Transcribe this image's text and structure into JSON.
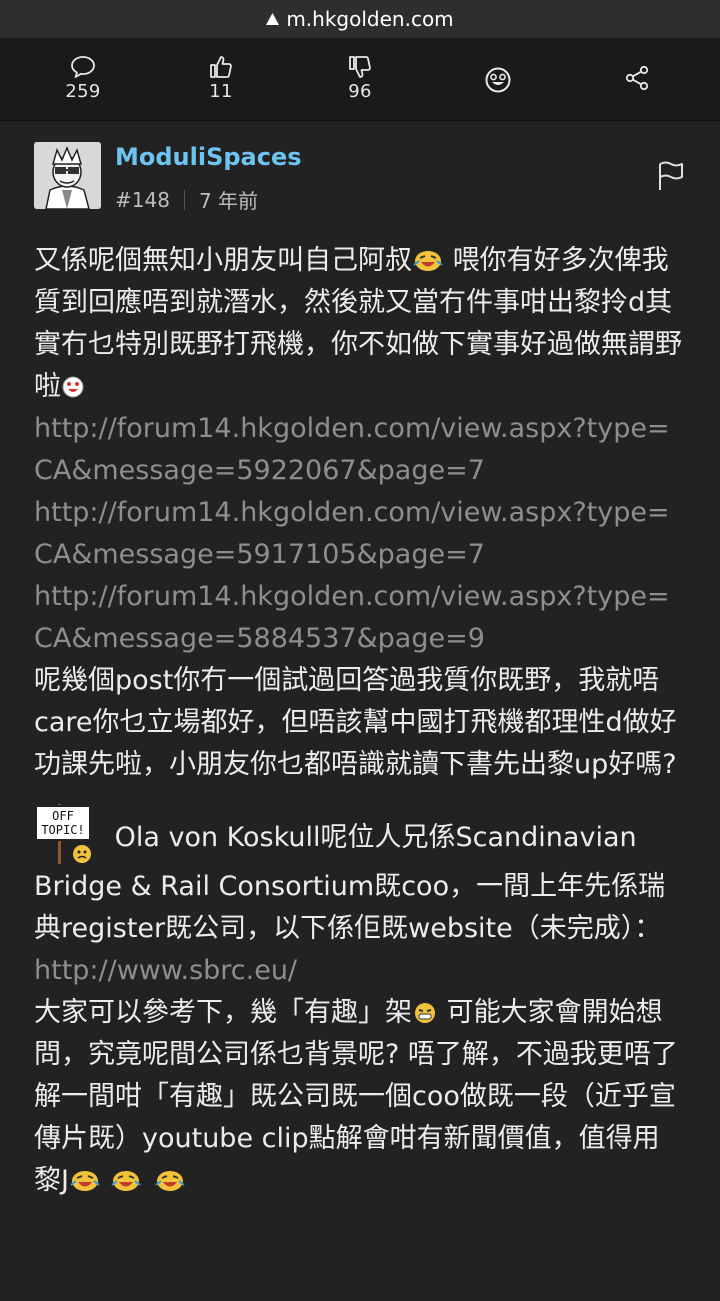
{
  "browser": {
    "url": "m.hkgolden.com"
  },
  "toolbar": {
    "comments": {
      "icon": "comment-bubble-icon",
      "count": "259"
    },
    "likes": {
      "icon": "thumbs-up-icon",
      "count": "11"
    },
    "dislikes": {
      "icon": "thumbs-down-icon",
      "count": "96"
    },
    "emoji": {
      "icon": "emoji-face-icon"
    },
    "share": {
      "icon": "share-icon"
    }
  },
  "post": {
    "author": "ModuliSpaces",
    "floor": "#148",
    "time": "7 年前",
    "accent_color": "#6ec4f0",
    "paragraphs": {
      "p1a": "又係呢個無知小朋友叫自己阿叔",
      "p1b": " 喂你有好多次俾我質到回應唔到就潛水，然後就又當冇件事咁出黎拎d其實冇乜特別既野打飛機，你不如做下實事好過做無謂野啦",
      "link1": "http://forum14.hkgolden.com/view.aspx?type=CA&message=5922067&page=7",
      "link2": "http://forum14.hkgolden.com/view.aspx?type=CA&message=5917105&page=7",
      "link3": "http://forum14.hkgolden.com/view.aspx?type=CA&message=5884537&page=9",
      "p2": "呢幾個post你冇一個試過回答過我質你既野，我就唔care你乜立場都好，但唔該幫中國打飛機都理性d做好功課先啦，小朋友你乜都唔識就讀下書先出黎up好嗎?",
      "offtopic_sign": "OFF TOPIC!",
      "p3": " Ola von Koskull呢位人兄係Scandinavian Bridge & Rail Consortium既coo，一間上年先係瑞典register既公司，以下係佢既website（未完成）：",
      "link4": "http://www.sbrc.eu/",
      "p4a": "大家可以參考下，幾「有趣」架",
      "p4b": " 可能大家會開始想問，究竟呢間公司係乜背景呢? 唔了解，不過我更唔了解一間咁「有趣」既公司既一個coo做既一段（近乎宣傳片既）youtube clip點解會咁有新聞價值，值得用黎J"
    }
  }
}
